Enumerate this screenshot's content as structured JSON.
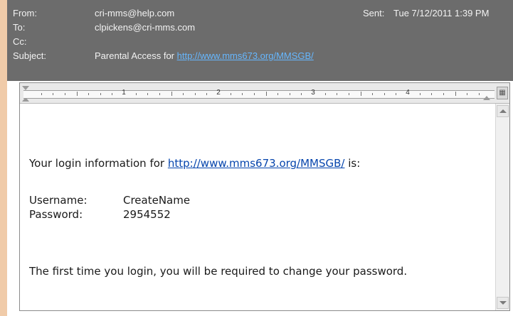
{
  "header": {
    "from_label": "From:",
    "from_value": "cri-mms@help.com",
    "to_label": "To:",
    "to_value": "clpickens@cri-mms.com",
    "cc_label": "Cc:",
    "cc_value": "",
    "subject_label": "Subject:",
    "subject_prefix": "Parental Access for",
    "subject_link": "http://www.mms673.org/MMSGB/",
    "sent_label": "Sent:",
    "sent_value": "Tue 7/12/2011 1:39 PM"
  },
  "ruler": {
    "numbers": [
      "1",
      "2",
      "3",
      "4"
    ]
  },
  "message": {
    "intro_prefix": "Your login information for",
    "intro_link": "http://www.mms673.org/MMSGB/",
    "intro_suffix": "is:",
    "username_label": "Username:",
    "username_value": "CreateName",
    "password_label": "Password:",
    "password_value": "2954552",
    "notice": "The first time you login, you will be required to change your password."
  },
  "colors": {
    "header_bg": "#6c6c6c",
    "link": "#0645ad",
    "header_link": "#66b7ff",
    "accent": "#f0cba9"
  }
}
